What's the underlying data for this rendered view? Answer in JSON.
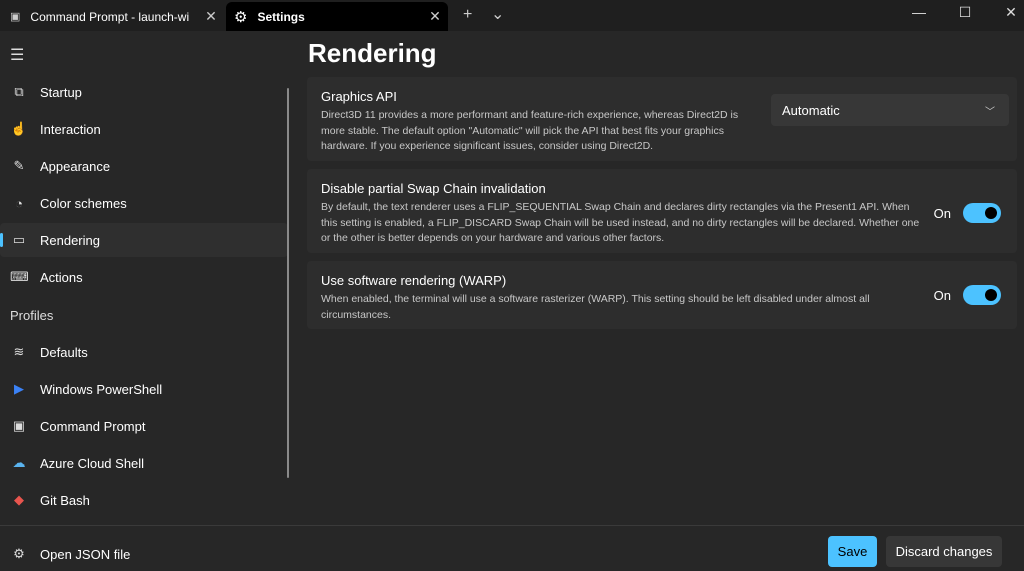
{
  "tabs": [
    {
      "label": "Command Prompt - launch-wi",
      "icon": "cmd-icon"
    },
    {
      "label": "Settings",
      "icon": "gear-icon",
      "active": true
    }
  ],
  "window": {
    "new_tab": "+",
    "dropdown": "⌄",
    "minimize": "—",
    "maximize": "☐",
    "close": "✕"
  },
  "sidebar": {
    "items": [
      {
        "label": "Startup",
        "icon": "startup-icon",
        "glyph": "⧉"
      },
      {
        "label": "Interaction",
        "icon": "interaction-icon",
        "glyph": "☝"
      },
      {
        "label": "Appearance",
        "icon": "brush-icon",
        "glyph": "✎"
      },
      {
        "label": "Color schemes",
        "icon": "palette-icon",
        "glyph": "◔"
      },
      {
        "label": "Rendering",
        "icon": "laptop-icon",
        "glyph": "▭",
        "selected": true
      },
      {
        "label": "Actions",
        "icon": "keyboard-icon",
        "glyph": "⌨"
      }
    ],
    "profiles_header": "Profiles",
    "profiles": [
      {
        "label": "Defaults",
        "icon": "layers-icon",
        "glyph": "≋"
      },
      {
        "label": "Windows PowerShell",
        "icon": "powershell-icon",
        "glyph": "▶"
      },
      {
        "label": "Command Prompt",
        "icon": "cmd-icon",
        "glyph": "▣"
      },
      {
        "label": "Azure Cloud Shell",
        "icon": "azure-icon",
        "glyph": "☁"
      },
      {
        "label": "Git Bash",
        "icon": "git-icon",
        "glyph": "◆"
      }
    ],
    "open_json": {
      "label": "Open JSON file",
      "icon": "gear-icon",
      "glyph": "⚙"
    }
  },
  "main": {
    "title": "Rendering",
    "graphics_api": {
      "title": "Graphics API",
      "desc": "Direct3D 11 provides a more performant and feature-rich experience, whereas Direct2D is more stable. The default option \"Automatic\" will pick the API that best fits your graphics hardware. If you experience significant issues, consider using Direct2D.",
      "value": "Automatic"
    },
    "swap_chain": {
      "title": "Disable partial Swap Chain invalidation",
      "desc": "By default, the text renderer uses a FLIP_SEQUENTIAL Swap Chain and declares dirty rectangles via the Present1 API. When this setting is enabled, a FLIP_DISCARD Swap Chain will be used instead, and no dirty rectangles will be declared. Whether one or the other is better depends on your hardware and various other factors.",
      "state": "On",
      "on": true
    },
    "warp": {
      "title": "Use software rendering (WARP)",
      "desc": "When enabled, the terminal will use a software rasterizer (WARP). This setting should be left disabled under almost all circumstances.",
      "state": "On",
      "on": true
    }
  },
  "footer": {
    "save": "Save",
    "discard": "Discard changes"
  },
  "colors": {
    "accent": "#4cc2ff",
    "background": "#272727",
    "card": "#2d2d2d"
  }
}
